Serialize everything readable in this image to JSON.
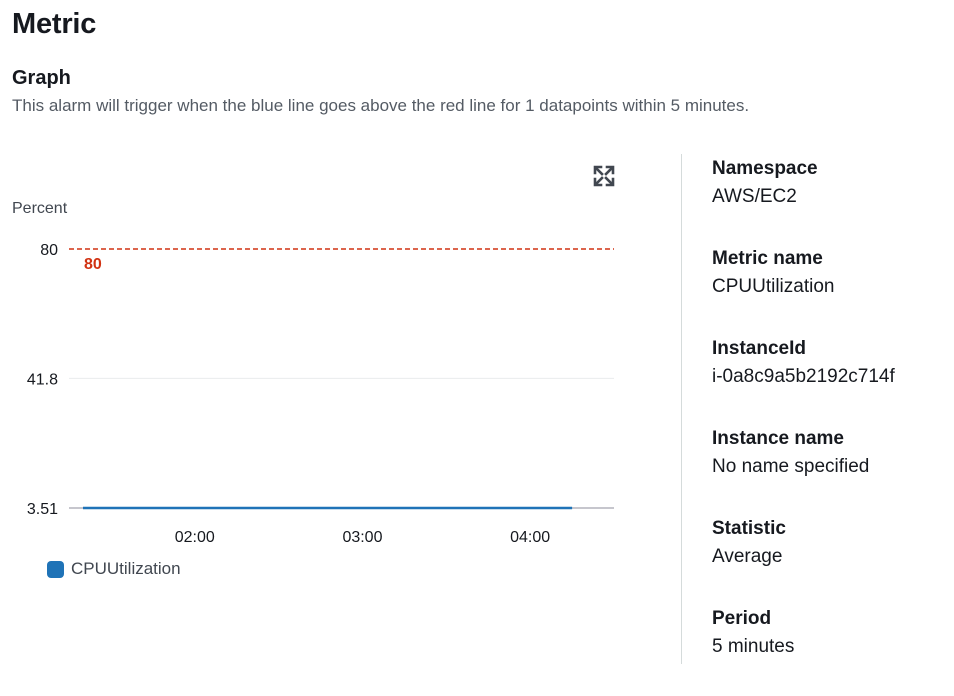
{
  "header": {
    "title": "Metric"
  },
  "graph": {
    "title": "Graph",
    "description": "This alarm will trigger when the blue line goes above the red line for 1 datapoints within 5 minutes."
  },
  "colors": {
    "metric_line": "#1f73b7",
    "threshold_line": "#d13212",
    "threshold_label": "#d13212",
    "gridline": "#e9ebed",
    "axis_text": "#16191f"
  },
  "icons": {
    "expand": "expand-icon"
  },
  "chart_data": {
    "type": "line",
    "ylabel": "Percent",
    "yticks": [
      "80",
      "41.8",
      "3.51"
    ],
    "ytick_values": [
      80,
      41.8,
      3.51
    ],
    "ylim": [
      3.51,
      80
    ],
    "x": [
      "01:20",
      "01:25",
      "01:30",
      "01:35",
      "01:40",
      "01:45",
      "01:50",
      "01:55",
      "02:00",
      "02:05",
      "02:10",
      "02:15",
      "02:20",
      "02:25",
      "02:30",
      "02:35",
      "02:40",
      "02:45",
      "02:50",
      "02:55",
      "03:00",
      "03:05",
      "03:10",
      "03:15",
      "03:20",
      "03:25",
      "03:30",
      "03:35",
      "03:40",
      "03:45",
      "03:50",
      "03:55",
      "04:00",
      "04:05",
      "04:10",
      "04:15"
    ],
    "xticks": [
      "02:00",
      "03:00",
      "04:00"
    ],
    "xlim": [
      "01:15",
      "04:30"
    ],
    "series": [
      {
        "name": "CPUUtilization",
        "values": [
          3.51,
          3.51,
          3.51,
          3.51,
          3.51,
          3.51,
          3.51,
          3.51,
          3.51,
          3.51,
          3.51,
          3.51,
          3.51,
          3.51,
          3.51,
          3.51,
          3.51,
          3.51,
          3.51,
          3.51,
          3.51,
          3.51,
          3.51,
          3.51,
          3.51,
          3.51,
          3.51,
          3.51,
          3.51,
          3.51,
          3.51,
          3.51,
          3.51,
          3.51,
          3.51,
          3.51
        ]
      }
    ],
    "threshold": {
      "value": 80,
      "label": "80",
      "style": "dashed"
    },
    "grid": true,
    "legend_position": "bottom-left"
  },
  "details": [
    {
      "key": "Namespace",
      "value": "AWS/EC2"
    },
    {
      "key": "Metric name",
      "value": "CPUUtilization"
    },
    {
      "key": "InstanceId",
      "value": "i-0a8c9a5b2192c714f"
    },
    {
      "key": "Instance name",
      "value": "No name specified"
    },
    {
      "key": "Statistic",
      "value": "Average"
    },
    {
      "key": "Period",
      "value": "5 minutes"
    }
  ]
}
